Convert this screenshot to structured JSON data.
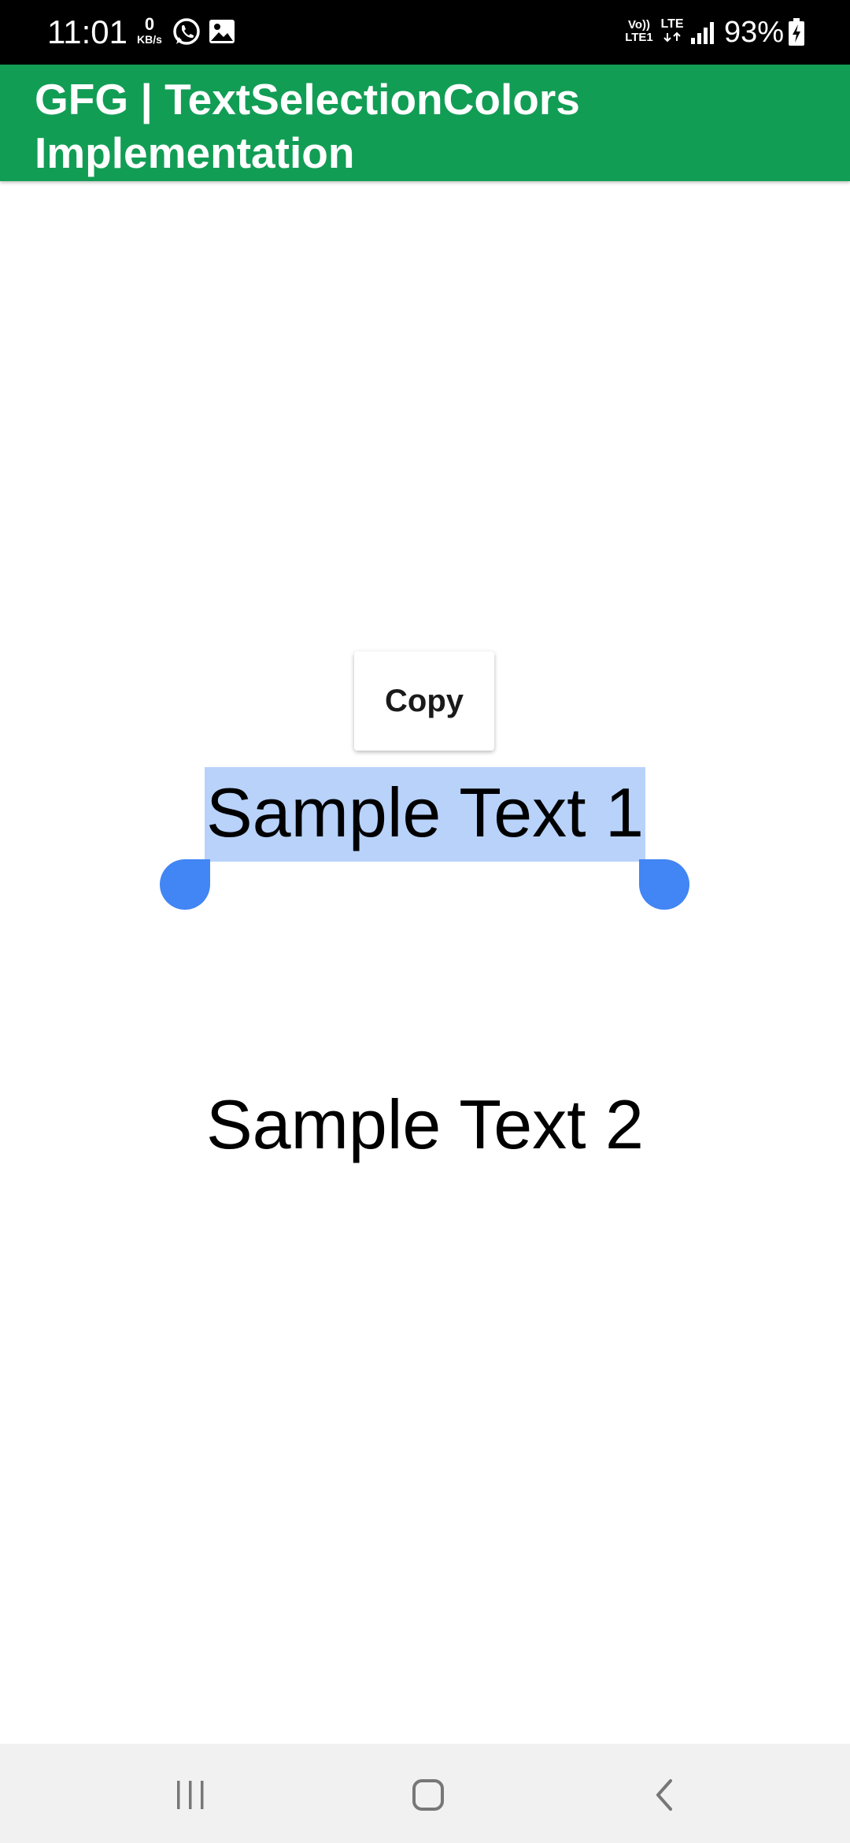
{
  "status_bar": {
    "time": "11:01",
    "data_speed_value": "0",
    "data_speed_unit": "KB/s",
    "volte_top": "Vo))",
    "volte_bottom": "LTE1",
    "network": "LTE",
    "battery": "93%",
    "icons": [
      "whatsapp-icon",
      "gallery-icon",
      "signal-icon",
      "battery-charging-icon"
    ]
  },
  "app_bar": {
    "title": "GFG | TextSelectionColors Implementation",
    "background": "#129d55"
  },
  "selection_toolbar": {
    "copy_label": "Copy"
  },
  "content": {
    "sample_text_1": "Sample Text 1",
    "sample_text_2": "Sample Text 2",
    "selection_highlight_color": "#b8d2fa",
    "selection_handle_color": "#4285f4"
  },
  "nav_bar": {
    "buttons": [
      "recents-icon",
      "home-icon",
      "back-icon"
    ]
  }
}
